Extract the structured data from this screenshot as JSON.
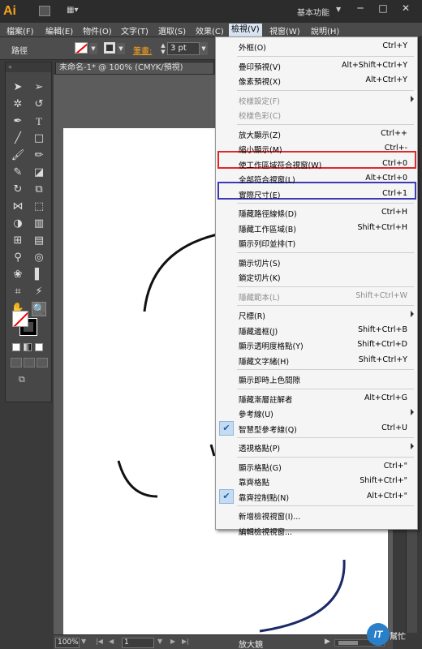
{
  "app": {
    "logo_text": "Ai",
    "workspace_label": "基本功能",
    "document_tab": "未命名-1* @ 100% (CMYK/預視)"
  },
  "window_controls": {
    "minimize": "─",
    "restore": "□",
    "close": "✕"
  },
  "menubar": {
    "items": [
      {
        "label": "檔案(F)"
      },
      {
        "label": "編輯(E)"
      },
      {
        "label": "物件(O)"
      },
      {
        "label": "文字(T)"
      },
      {
        "label": "選取(S)"
      },
      {
        "label": "效果(C)"
      },
      {
        "label": "檢視(V)",
        "active": true
      },
      {
        "label": "視窗(W)"
      },
      {
        "label": "說明(H)"
      }
    ]
  },
  "controlbar": {
    "selection_label": "路徑",
    "stroke_label": "筆畫:",
    "stroke_weight": "3 pt"
  },
  "tools": [
    "selection-tool-icon",
    "direct-selection-tool-icon",
    "magic-wand-tool-icon",
    "lasso-tool-icon",
    "pen-tool-icon",
    "type-tool-icon",
    "line-segment-tool-icon",
    "rectangle-tool-icon",
    "paintbrush-tool-icon",
    "pencil-tool-icon",
    "blob-brush-tool-icon",
    "eraser-tool-icon",
    "rotate-tool-icon",
    "scale-tool-icon",
    "width-tool-icon",
    "free-transform-tool-icon",
    "shape-builder-tool-icon",
    "perspective-grid-tool-icon",
    "mesh-tool-icon",
    "gradient-tool-icon",
    "eyedropper-tool-icon",
    "blend-tool-icon",
    "symbol-sprayer-tool-icon",
    "column-graph-tool-icon",
    "artboard-tool-icon",
    "slice-tool-icon",
    "hand-tool-icon",
    "zoom-tool-icon"
  ],
  "status": {
    "zoom": "100%",
    "page": "1",
    "current_tool": "放大鏡"
  },
  "watermark": {
    "logo": "IT",
    "text": "幫忙"
  },
  "view_menu": {
    "highlight_colors": {
      "red": "#e0282a",
      "blue": "#3a3bb8"
    },
    "items": [
      {
        "label": "外框(O)",
        "shortcut": "Ctrl+Y"
      },
      {
        "separator": true
      },
      {
        "label": "疊印預視(V)",
        "shortcut": "Alt+Shift+Ctrl+Y"
      },
      {
        "label": "像素預視(X)",
        "shortcut": "Alt+Ctrl+Y"
      },
      {
        "separator": true
      },
      {
        "label": "校樣設定(F)",
        "shortcut": "",
        "disabled": true,
        "submenu": true
      },
      {
        "label": "校樣色彩(C)",
        "shortcut": "",
        "disabled": true
      },
      {
        "separator": true
      },
      {
        "label": "放大顯示(Z)",
        "shortcut": "Ctrl++"
      },
      {
        "label": "縮小顯示(M)",
        "shortcut": "Ctrl+-"
      },
      {
        "label": "使工作區域符合視窗(W)",
        "shortcut": "Ctrl+0",
        "highlight": "red"
      },
      {
        "label": "全部符合視窗(L)",
        "shortcut": "Alt+Ctrl+0"
      },
      {
        "label": "實際尺寸(E)",
        "shortcut": "Ctrl+1",
        "highlight": "blue"
      },
      {
        "separator": true
      },
      {
        "label": "隱藏路徑線條(D)",
        "shortcut": "Ctrl+H"
      },
      {
        "label": "隱藏工作區域(B)",
        "shortcut": "Shift+Ctrl+H"
      },
      {
        "label": "顯示列印並排(T)",
        "shortcut": ""
      },
      {
        "separator": true
      },
      {
        "label": "顯示切片(S)",
        "shortcut": ""
      },
      {
        "label": "鎖定切片(K)",
        "shortcut": ""
      },
      {
        "separator": true
      },
      {
        "label": "隱藏範本(L)",
        "shortcut": "Shift+Ctrl+W",
        "disabled": true
      },
      {
        "separator": true
      },
      {
        "label": "尺標(R)",
        "shortcut": "",
        "submenu": true
      },
      {
        "label": "隱藏邊框(J)",
        "shortcut": "Shift+Ctrl+B"
      },
      {
        "label": "顯示透明度格點(Y)",
        "shortcut": "Shift+Ctrl+D"
      },
      {
        "label": "隱藏文字緒(H)",
        "shortcut": "Shift+Ctrl+Y"
      },
      {
        "separator": true
      },
      {
        "label": "顯示即時上色間隙",
        "shortcut": ""
      },
      {
        "separator": true
      },
      {
        "label": "隱藏漸層註解者",
        "shortcut": "Alt+Ctrl+G"
      },
      {
        "label": "參考線(U)",
        "shortcut": "",
        "submenu": true
      },
      {
        "label": "智慧型參考線(Q)",
        "shortcut": "Ctrl+U",
        "checked": true
      },
      {
        "separator": true
      },
      {
        "label": "透視格點(P)",
        "shortcut": "",
        "submenu": true
      },
      {
        "separator": true
      },
      {
        "label": "顯示格點(G)",
        "shortcut": "Ctrl+\""
      },
      {
        "label": "靠齊格點",
        "shortcut": "Shift+Ctrl+\""
      },
      {
        "label": "靠齊控制點(N)",
        "shortcut": "Alt+Ctrl+\"",
        "checked": true
      },
      {
        "separator": true
      },
      {
        "label": "新增檢視視窗(I)...",
        "shortcut": ""
      },
      {
        "label": "編輯檢視視窗...",
        "shortcut": ""
      }
    ]
  }
}
